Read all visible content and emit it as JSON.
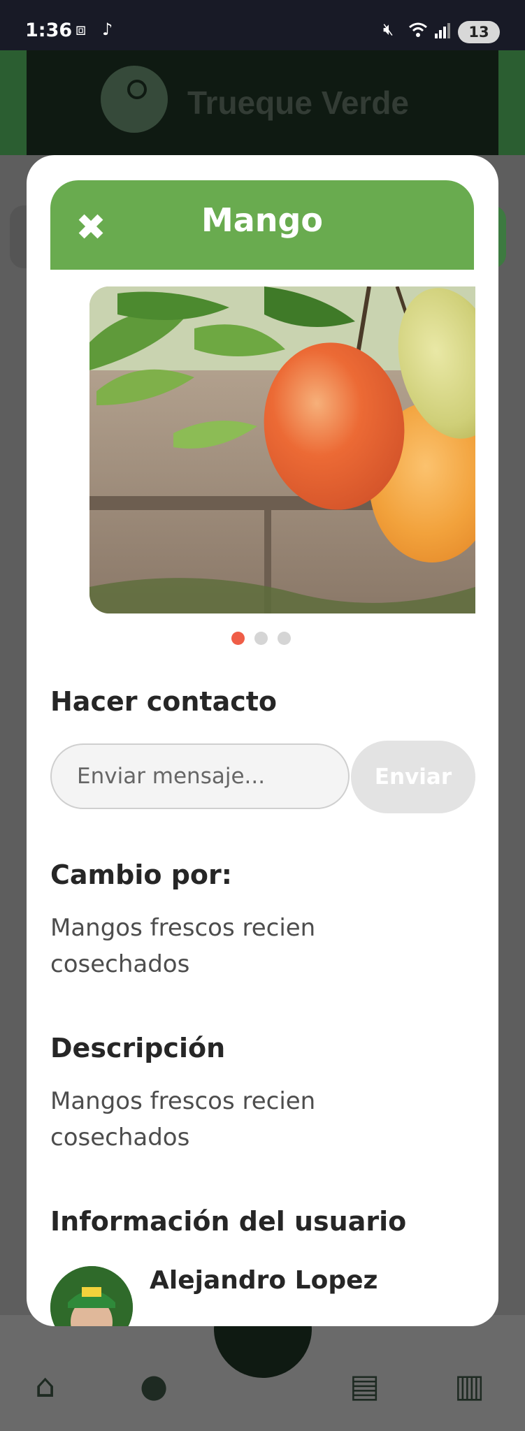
{
  "status_bar": {
    "time": "1:36",
    "battery": "13",
    "icons": [
      "screenshot-icon",
      "tiktok-icon",
      "mute-icon",
      "wifi-icon",
      "signal-icon",
      "battery-icon"
    ]
  },
  "background": {
    "app_name": "Trueque Verde",
    "nav_icons": [
      "home-icon",
      "profile-icon",
      "add-icon",
      "messages-icon",
      "map-icon"
    ]
  },
  "modal": {
    "title": "Mango",
    "carousel": {
      "slide_count": 3,
      "active_index": 0
    },
    "contact": {
      "heading": "Hacer contacto",
      "placeholder": "Enviar mensaje...",
      "send_label": "Enviar"
    },
    "exchange": {
      "heading": "Cambio por:",
      "text": "Mangos frescos recien cosechados"
    },
    "description": {
      "heading": "Descripción",
      "text": "Mangos frescos recien cosechados"
    },
    "user_info": {
      "heading": "Información del usuario",
      "name": "Alejandro Lopez"
    }
  },
  "colors": {
    "header_green": "#69ab4f",
    "active_dot": "#ef5d47",
    "inactive_dot": "#d5d5d5",
    "send_disabled": "#e3e3e3"
  }
}
